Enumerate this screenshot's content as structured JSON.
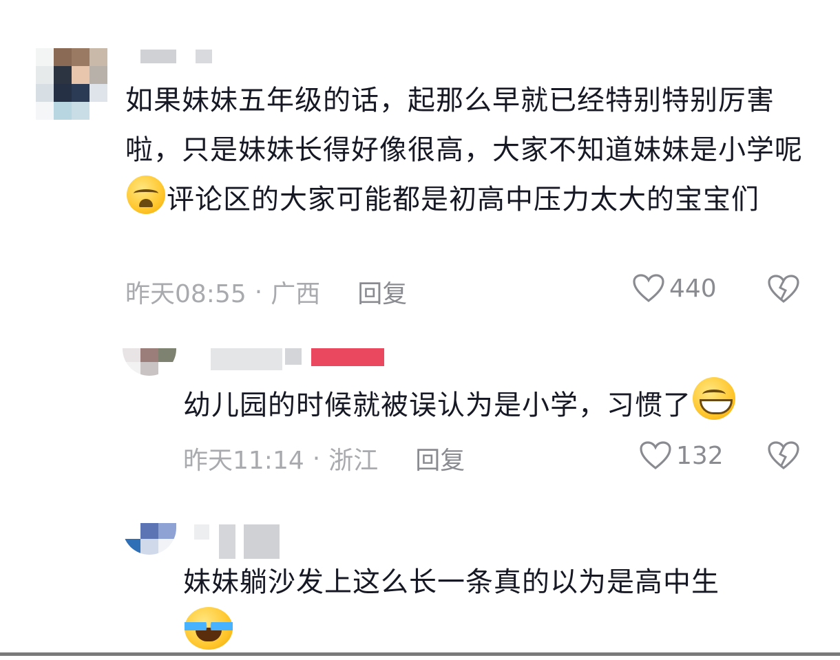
{
  "comments": [
    {
      "text_before": "如果妹妹五年级的话，起那么早就已经特别特别厉害啦，只是妹妹长得好像很高，大家不知道妹妹是小学呢",
      "emoji": "loudly-crying-face",
      "text_after": "评论区的大家可能都是初高中压力太大的宝宝们",
      "time": "昨天08:55",
      "location": "广西",
      "reply_label": "回复",
      "likes": "440"
    },
    {
      "text_before": "幼儿园的时候就被误认为是小学，习惯了",
      "emoji": "grinning-face",
      "text_after": "",
      "time": "昨天11:14",
      "location": "浙江",
      "reply_label": "回复",
      "likes": "132"
    },
    {
      "text_before": "妹妹躺沙发上这么长一条真的以为是高中生",
      "emoji": "face-with-tears-of-joy",
      "text_after": "",
      "time": "",
      "location": "",
      "reply_label": "",
      "likes": ""
    }
  ],
  "separator": "·",
  "colors": {
    "text": "#161823",
    "meta": "#a9aaae",
    "action": "#8a8b91",
    "author_tag": "#e8344e"
  }
}
